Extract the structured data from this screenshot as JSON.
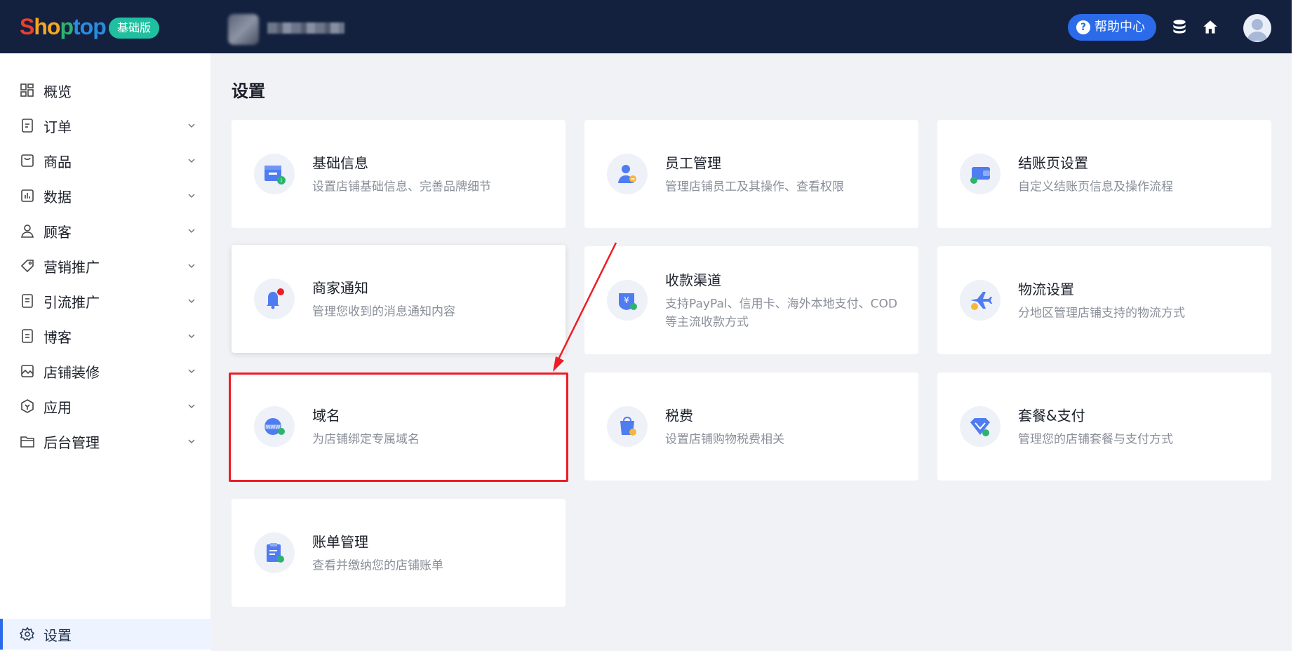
{
  "header": {
    "brand": "Shoptop",
    "plan_badge": "基础版",
    "help_label": "帮助中心",
    "icons": [
      "question-icon",
      "database-icon",
      "home-icon",
      "user-avatar-icon"
    ]
  },
  "sidebar": {
    "items": [
      {
        "label": "概览",
        "icon": "dashboard-icon"
      },
      {
        "label": "订单",
        "icon": "order-icon"
      },
      {
        "label": "商品",
        "icon": "product-icon"
      },
      {
        "label": "数据",
        "icon": "chart-icon"
      },
      {
        "label": "顾客",
        "icon": "customer-icon"
      },
      {
        "label": "营销推广",
        "icon": "tag-icon"
      },
      {
        "label": "引流推广",
        "icon": "traffic-icon"
      },
      {
        "label": "博客",
        "icon": "blog-icon"
      },
      {
        "label": "店铺装修",
        "icon": "decorate-icon"
      },
      {
        "label": "应用",
        "icon": "app-icon"
      },
      {
        "label": "后台管理",
        "icon": "folder-icon"
      }
    ],
    "settings_label": "设置"
  },
  "main": {
    "title": "设置",
    "cards": [
      {
        "title": "基础信息",
        "desc": "设置店铺基础信息、完善品牌细节",
        "icon": "store-info-icon"
      },
      {
        "title": "员工管理",
        "desc": "管理店铺员工及其操作、查看权限",
        "icon": "staff-icon"
      },
      {
        "title": "结账页设置",
        "desc": "自定义结账页信息及操作流程",
        "icon": "wallet-icon"
      },
      {
        "title": "商家通知",
        "desc": "管理您收到的消息通知内容",
        "icon": "bell-icon"
      },
      {
        "title": "收款渠道",
        "desc": "支持PayPal、信用卡、海外本地支付、COD等主流收款方式",
        "icon": "payment-icon"
      },
      {
        "title": "物流设置",
        "desc": "分地区管理店铺支持的物流方式",
        "icon": "plane-icon"
      },
      {
        "title": "域名",
        "desc": "为店铺绑定专属域名",
        "icon": "www-icon"
      },
      {
        "title": "税费",
        "desc": "设置店铺购物税费相关",
        "icon": "tax-icon"
      },
      {
        "title": "套餐&支付",
        "desc": "管理您的店铺套餐与支付方式",
        "icon": "diamond-icon"
      },
      {
        "title": "账单管理",
        "desc": "查看并缴纳您的店铺账单",
        "icon": "bill-icon"
      }
    ]
  },
  "colors": {
    "header_bg": "#13213f",
    "accent": "#2b6bea",
    "badge": "#1fbf9f",
    "highlight": "#ee1c25"
  }
}
